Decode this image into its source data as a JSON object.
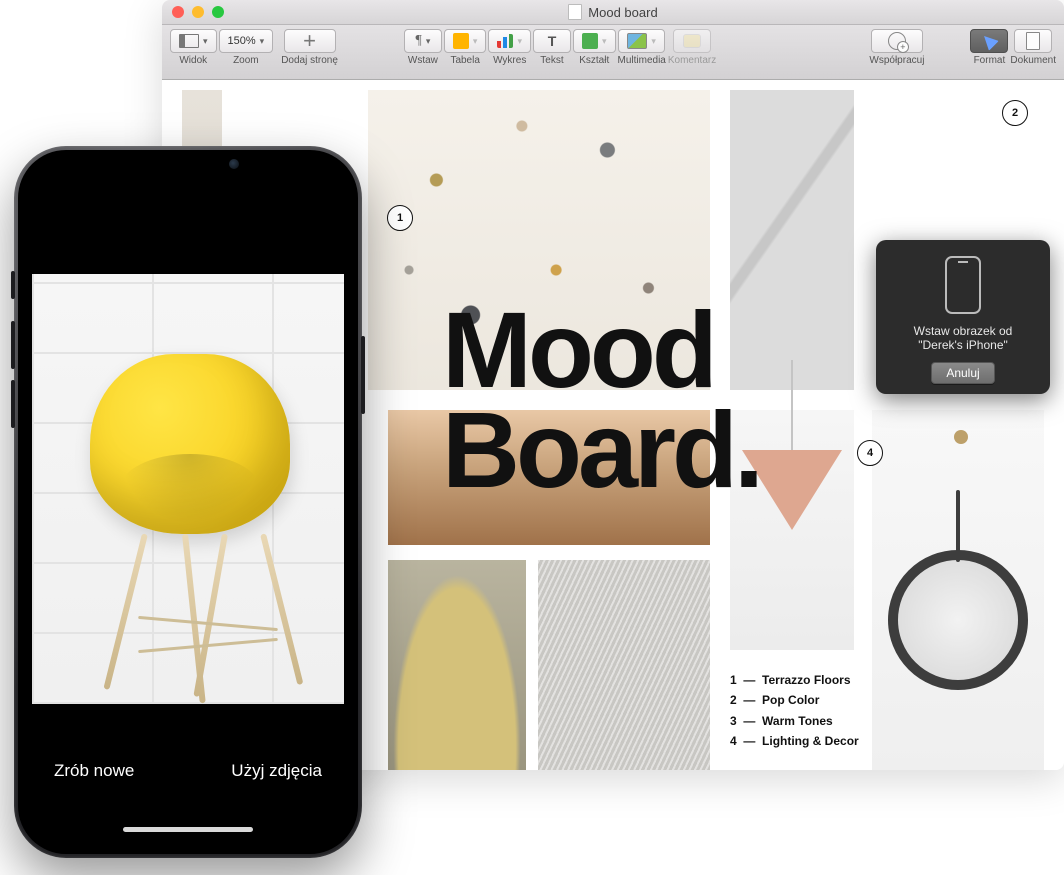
{
  "window": {
    "title": "Mood board"
  },
  "toolbar": {
    "view": {
      "label": "Widok"
    },
    "zoom": {
      "label": "Zoom",
      "value": "150%"
    },
    "add_page": {
      "label": "Dodaj stronę"
    },
    "insert": {
      "label": "Wstaw"
    },
    "table": {
      "label": "Tabela"
    },
    "chart": {
      "label": "Wykres"
    },
    "text": {
      "label": "Tekst"
    },
    "shape": {
      "label": "Kształt"
    },
    "media": {
      "label": "Multimedia"
    },
    "comment": {
      "label": "Komentarz"
    },
    "collaborate": {
      "label": "Współpracuj"
    },
    "format": {
      "label": "Format"
    },
    "document": {
      "label": "Dokument"
    }
  },
  "document": {
    "title_line1": "Mood",
    "title_line2": "Board.",
    "markers": {
      "m1": "1",
      "m2": "2",
      "m4": "4"
    },
    "legend": [
      {
        "n": "1",
        "label": "Terrazzo Floors"
      },
      {
        "n": "2",
        "label": "Pop Color"
      },
      {
        "n": "3",
        "label": "Warm Tones"
      },
      {
        "n": "4",
        "label": "Lighting & Decor"
      }
    ]
  },
  "popover": {
    "text_line1": "Wstaw obrazek od",
    "text_line2": "\"Derek's iPhone\"",
    "cancel": "Anuluj"
  },
  "iphone": {
    "retake": "Zrób nowe",
    "use_photo": "Użyj zdjęcia"
  }
}
